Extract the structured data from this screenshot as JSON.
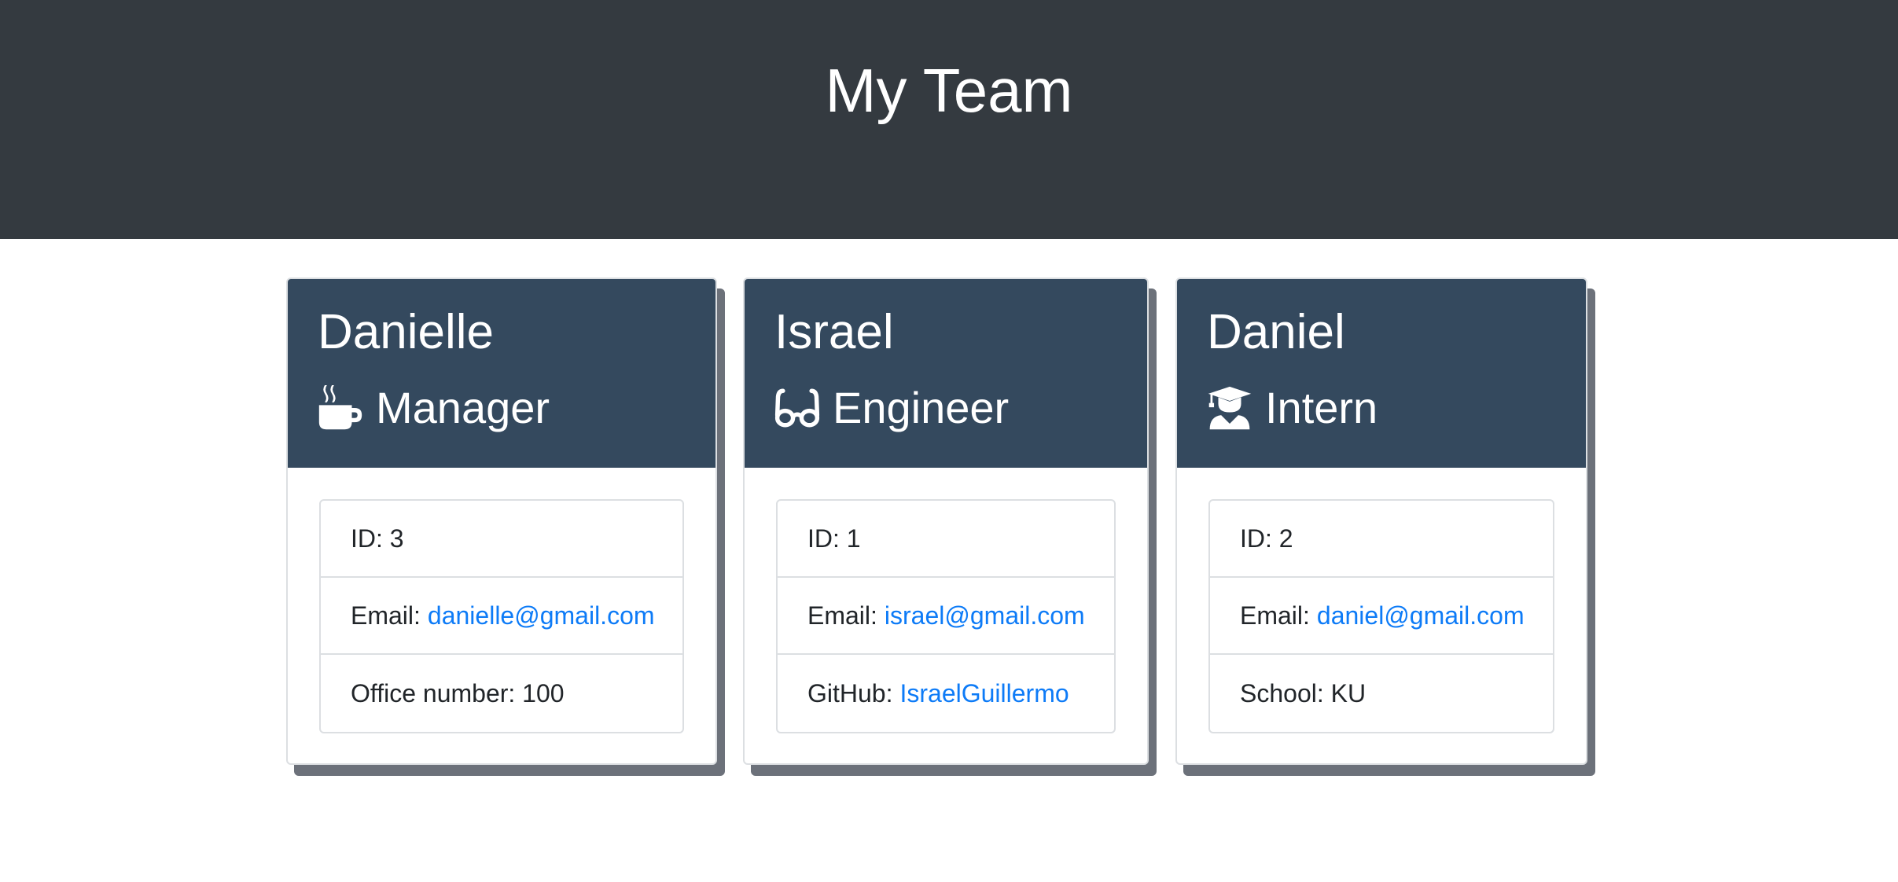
{
  "header": {
    "title": "My Team"
  },
  "team": [
    {
      "name": "Danielle",
      "role": "Manager",
      "icon": "coffee-icon",
      "id_text": "ID: 3",
      "email_label": "Email:",
      "email": "danielle@gmail.com",
      "extra_text": "Office number: 100"
    },
    {
      "name": "Israel",
      "role": "Engineer",
      "icon": "glasses-icon",
      "id_text": "ID: 1",
      "email_label": "Email:",
      "email": "israel@gmail.com",
      "extra_label": "GitHub:",
      "github": "IsraelGuillermo"
    },
    {
      "name": "Daniel",
      "role": "Intern",
      "icon": "graduate-icon",
      "id_text": "ID: 2",
      "email_label": "Email:",
      "email": "daniel@gmail.com",
      "extra_text": "School: KU"
    }
  ],
  "colors": {
    "header_bg": "#343a40",
    "card_head_bg": "#34495e",
    "link": "#0d7bf7",
    "card_shadow": "#6c717a"
  }
}
